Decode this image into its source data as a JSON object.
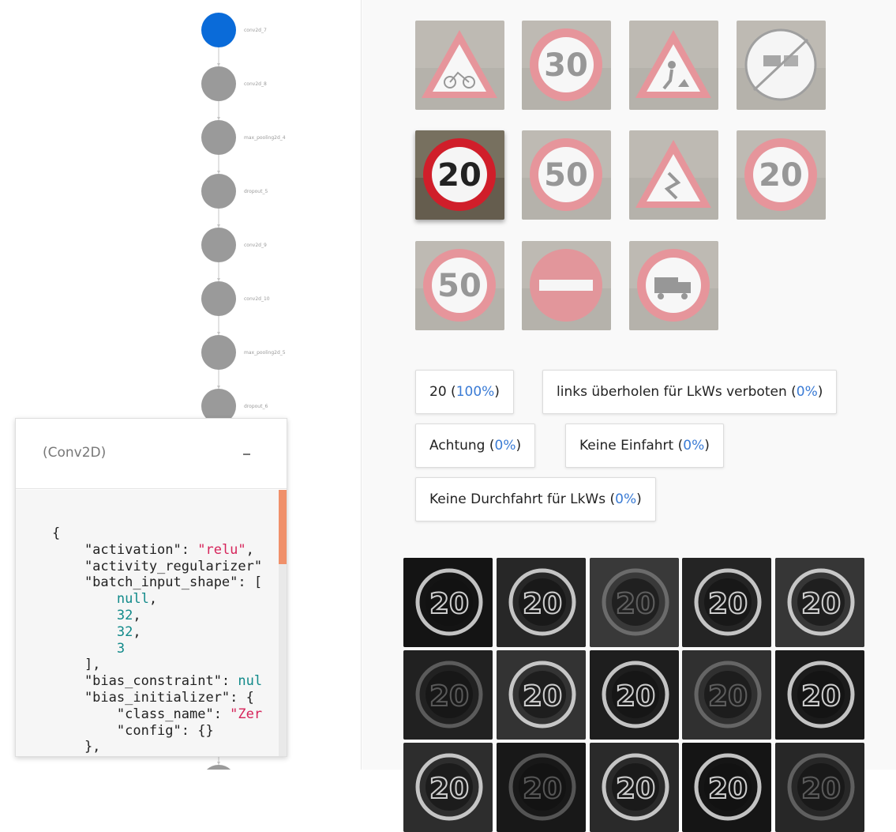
{
  "graph": {
    "nodes": [
      {
        "label": "conv2d_7",
        "active": true
      },
      {
        "label": "conv2d_8",
        "active": false
      },
      {
        "label": "max_pooling2d_4",
        "active": false
      },
      {
        "label": "dropout_5",
        "active": false
      },
      {
        "label": "conv2d_9",
        "active": false
      },
      {
        "label": "conv2d_10",
        "active": false
      },
      {
        "label": "max_pooling2d_5",
        "active": false
      },
      {
        "label": "dropout_6",
        "active": false
      }
    ],
    "colors": {
      "active": "#0a6bd9",
      "inactive": "#9a9a9a",
      "edge": "#c4c4c4"
    }
  },
  "details": {
    "title": "(Conv2D)",
    "code_lines": [
      [
        {
          "t": "k",
          "v": "{"
        }
      ],
      [
        {
          "t": "k",
          "v": "    \"activation\": "
        },
        {
          "t": "s",
          "v": "\"relu\""
        },
        {
          "t": "k",
          "v": ","
        }
      ],
      [
        {
          "t": "k",
          "v": "    \"activity_regularizer\""
        }
      ],
      [
        {
          "t": "k",
          "v": "    \"batch_input_shape\": ["
        }
      ],
      [
        {
          "t": "k",
          "v": "        "
        },
        {
          "t": "n",
          "v": "null"
        },
        {
          "t": "k",
          "v": ","
        }
      ],
      [
        {
          "t": "k",
          "v": "        "
        },
        {
          "t": "n",
          "v": "32"
        },
        {
          "t": "k",
          "v": ","
        }
      ],
      [
        {
          "t": "k",
          "v": "        "
        },
        {
          "t": "n",
          "v": "32"
        },
        {
          "t": "k",
          "v": ","
        }
      ],
      [
        {
          "t": "k",
          "v": "        "
        },
        {
          "t": "n",
          "v": "3"
        }
      ],
      [
        {
          "t": "k",
          "v": "    ],"
        }
      ],
      [
        {
          "t": "k",
          "v": "    \"bias_constraint\": "
        },
        {
          "t": "n",
          "v": "nul"
        }
      ],
      [
        {
          "t": "k",
          "v": "    \"bias_initializer\": {"
        }
      ],
      [
        {
          "t": "k",
          "v": "        \"class_name\": "
        },
        {
          "t": "s",
          "v": "\"Zer"
        }
      ],
      [
        {
          "t": "k",
          "v": "        \"config\": {}"
        }
      ],
      [
        {
          "t": "k",
          "v": "    },"
        }
      ]
    ]
  },
  "images": [
    {
      "icon": "warning-bicycle-sign",
      "text": "",
      "active": false
    },
    {
      "icon": "speed-limit-sign",
      "text": "30",
      "active": false
    },
    {
      "icon": "warning-roadworks-sign",
      "text": "",
      "active": false
    },
    {
      "icon": "end-no-overtaking-trucks-sign",
      "text": "",
      "active": false
    },
    {
      "icon": "speed-limit-sign",
      "text": "20",
      "active": true
    },
    {
      "icon": "speed-limit-sign",
      "text": "50",
      "active": false
    },
    {
      "icon": "warning-curve-sign",
      "text": "",
      "active": false
    },
    {
      "icon": "speed-limit-sign",
      "text": "20",
      "active": false
    },
    {
      "icon": "speed-limit-sign",
      "text": "50",
      "active": false
    },
    {
      "icon": "no-entry-sign",
      "text": "",
      "active": false
    },
    {
      "icon": "no-trucks-sign",
      "text": "",
      "active": false
    }
  ],
  "predictions": [
    {
      "label": "20",
      "pct": "(100%)"
    },
    {
      "label": "links überholen für LkWs verboten",
      "pct": "(0%)"
    },
    {
      "label": "Achtung",
      "pct": "(0%)"
    },
    {
      "label": "Keine Einfahrt",
      "pct": "(0%)"
    },
    {
      "label": "Keine Durchfahrt für LkWs",
      "pct": "(0%)"
    }
  ],
  "feature_maps": {
    "text": "20",
    "count": 15,
    "colors": {
      "ring": "#e0e0e0",
      "accent": "#d62828"
    }
  }
}
